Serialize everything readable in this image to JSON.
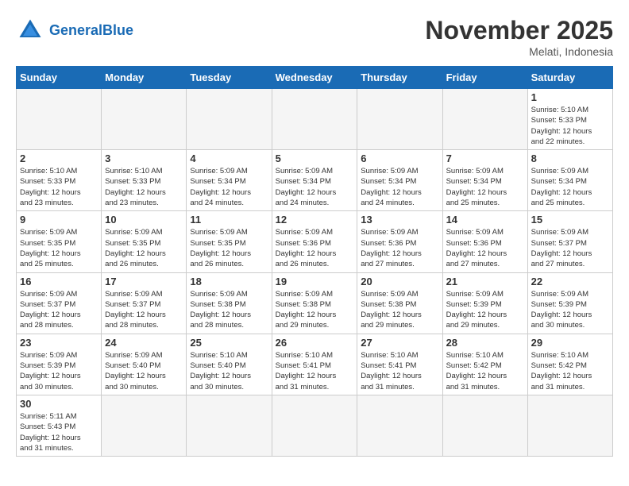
{
  "logo": {
    "text_general": "General",
    "text_blue": "Blue"
  },
  "title": "November 2025",
  "subtitle": "Melati, Indonesia",
  "headers": [
    "Sunday",
    "Monday",
    "Tuesday",
    "Wednesday",
    "Thursday",
    "Friday",
    "Saturday"
  ],
  "days": {
    "d1": {
      "num": "1",
      "info": "Sunrise: 5:10 AM\nSunset: 5:33 PM\nDaylight: 12 hours\nand 22 minutes."
    },
    "d2": {
      "num": "2",
      "info": "Sunrise: 5:10 AM\nSunset: 5:33 PM\nDaylight: 12 hours\nand 23 minutes."
    },
    "d3": {
      "num": "3",
      "info": "Sunrise: 5:10 AM\nSunset: 5:33 PM\nDaylight: 12 hours\nand 23 minutes."
    },
    "d4": {
      "num": "4",
      "info": "Sunrise: 5:09 AM\nSunset: 5:34 PM\nDaylight: 12 hours\nand 24 minutes."
    },
    "d5": {
      "num": "5",
      "info": "Sunrise: 5:09 AM\nSunset: 5:34 PM\nDaylight: 12 hours\nand 24 minutes."
    },
    "d6": {
      "num": "6",
      "info": "Sunrise: 5:09 AM\nSunset: 5:34 PM\nDaylight: 12 hours\nand 24 minutes."
    },
    "d7": {
      "num": "7",
      "info": "Sunrise: 5:09 AM\nSunset: 5:34 PM\nDaylight: 12 hours\nand 25 minutes."
    },
    "d8": {
      "num": "8",
      "info": "Sunrise: 5:09 AM\nSunset: 5:34 PM\nDaylight: 12 hours\nand 25 minutes."
    },
    "d9": {
      "num": "9",
      "info": "Sunrise: 5:09 AM\nSunset: 5:35 PM\nDaylight: 12 hours\nand 25 minutes."
    },
    "d10": {
      "num": "10",
      "info": "Sunrise: 5:09 AM\nSunset: 5:35 PM\nDaylight: 12 hours\nand 26 minutes."
    },
    "d11": {
      "num": "11",
      "info": "Sunrise: 5:09 AM\nSunset: 5:35 PM\nDaylight: 12 hours\nand 26 minutes."
    },
    "d12": {
      "num": "12",
      "info": "Sunrise: 5:09 AM\nSunset: 5:36 PM\nDaylight: 12 hours\nand 26 minutes."
    },
    "d13": {
      "num": "13",
      "info": "Sunrise: 5:09 AM\nSunset: 5:36 PM\nDaylight: 12 hours\nand 27 minutes."
    },
    "d14": {
      "num": "14",
      "info": "Sunrise: 5:09 AM\nSunset: 5:36 PM\nDaylight: 12 hours\nand 27 minutes."
    },
    "d15": {
      "num": "15",
      "info": "Sunrise: 5:09 AM\nSunset: 5:37 PM\nDaylight: 12 hours\nand 27 minutes."
    },
    "d16": {
      "num": "16",
      "info": "Sunrise: 5:09 AM\nSunset: 5:37 PM\nDaylight: 12 hours\nand 28 minutes."
    },
    "d17": {
      "num": "17",
      "info": "Sunrise: 5:09 AM\nSunset: 5:37 PM\nDaylight: 12 hours\nand 28 minutes."
    },
    "d18": {
      "num": "18",
      "info": "Sunrise: 5:09 AM\nSunset: 5:38 PM\nDaylight: 12 hours\nand 28 minutes."
    },
    "d19": {
      "num": "19",
      "info": "Sunrise: 5:09 AM\nSunset: 5:38 PM\nDaylight: 12 hours\nand 29 minutes."
    },
    "d20": {
      "num": "20",
      "info": "Sunrise: 5:09 AM\nSunset: 5:38 PM\nDaylight: 12 hours\nand 29 minutes."
    },
    "d21": {
      "num": "21",
      "info": "Sunrise: 5:09 AM\nSunset: 5:39 PM\nDaylight: 12 hours\nand 29 minutes."
    },
    "d22": {
      "num": "22",
      "info": "Sunrise: 5:09 AM\nSunset: 5:39 PM\nDaylight: 12 hours\nand 30 minutes."
    },
    "d23": {
      "num": "23",
      "info": "Sunrise: 5:09 AM\nSunset: 5:39 PM\nDaylight: 12 hours\nand 30 minutes."
    },
    "d24": {
      "num": "24",
      "info": "Sunrise: 5:09 AM\nSunset: 5:40 PM\nDaylight: 12 hours\nand 30 minutes."
    },
    "d25": {
      "num": "25",
      "info": "Sunrise: 5:10 AM\nSunset: 5:40 PM\nDaylight: 12 hours\nand 30 minutes."
    },
    "d26": {
      "num": "26",
      "info": "Sunrise: 5:10 AM\nSunset: 5:41 PM\nDaylight: 12 hours\nand 31 minutes."
    },
    "d27": {
      "num": "27",
      "info": "Sunrise: 5:10 AM\nSunset: 5:41 PM\nDaylight: 12 hours\nand 31 minutes."
    },
    "d28": {
      "num": "28",
      "info": "Sunrise: 5:10 AM\nSunset: 5:42 PM\nDaylight: 12 hours\nand 31 minutes."
    },
    "d29": {
      "num": "29",
      "info": "Sunrise: 5:10 AM\nSunset: 5:42 PM\nDaylight: 12 hours\nand 31 minutes."
    },
    "d30": {
      "num": "30",
      "info": "Sunrise: 5:11 AM\nSunset: 5:43 PM\nDaylight: 12 hours\nand 31 minutes."
    }
  }
}
